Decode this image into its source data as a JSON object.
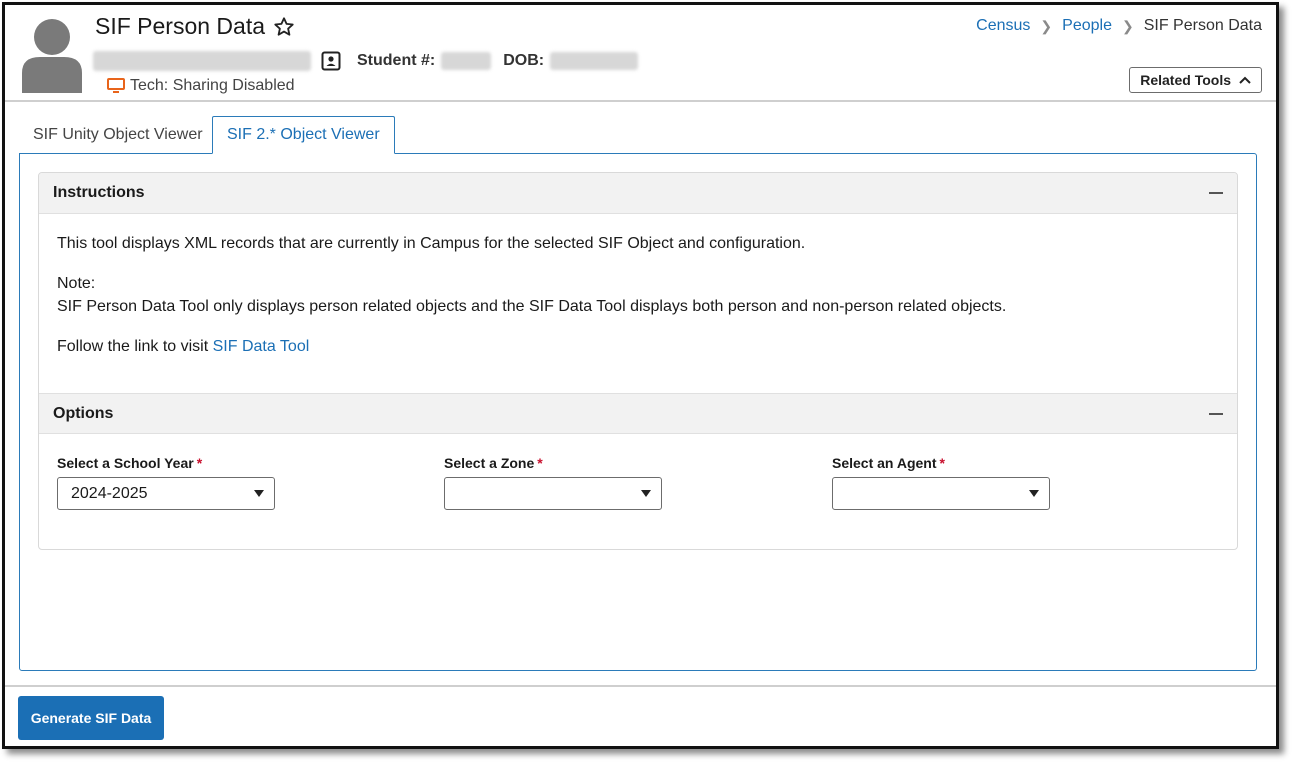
{
  "header": {
    "title": "SIF Person Data",
    "student_label": "Student #:",
    "dob_label": "DOB:",
    "tech_status": "Tech: Sharing Disabled",
    "related_tools_label": "Related Tools"
  },
  "breadcrumb": {
    "items": [
      "Census",
      "People",
      "SIF Person Data"
    ]
  },
  "tabs": [
    {
      "label": "SIF Unity Object Viewer",
      "active": false
    },
    {
      "label": "SIF 2.* Object Viewer",
      "active": true
    }
  ],
  "instructions": {
    "heading": "Instructions",
    "line1": "This tool displays XML records that are currently in Campus for the selected SIF Object and configuration.",
    "note_label": "Note:",
    "note_text": "SIF Person Data Tool only displays person related objects and the SIF Data Tool displays both person and non-person related objects.",
    "follow_text": "Follow the link to visit",
    "link_text": "SIF Data Tool"
  },
  "options": {
    "heading": "Options",
    "fields": [
      {
        "label": "Select a School Year",
        "required_mark": "*",
        "value": "2024-2025"
      },
      {
        "label": "Select a Zone",
        "required_mark": "*",
        "value": ""
      },
      {
        "label": "Select an Agent",
        "required_mark": "*",
        "value": ""
      }
    ]
  },
  "footer": {
    "generate_label": "Generate SIF Data"
  },
  "colors": {
    "accent": "#1b6fb5",
    "required": "#c8102e",
    "tech_icon": "#e8641b"
  }
}
